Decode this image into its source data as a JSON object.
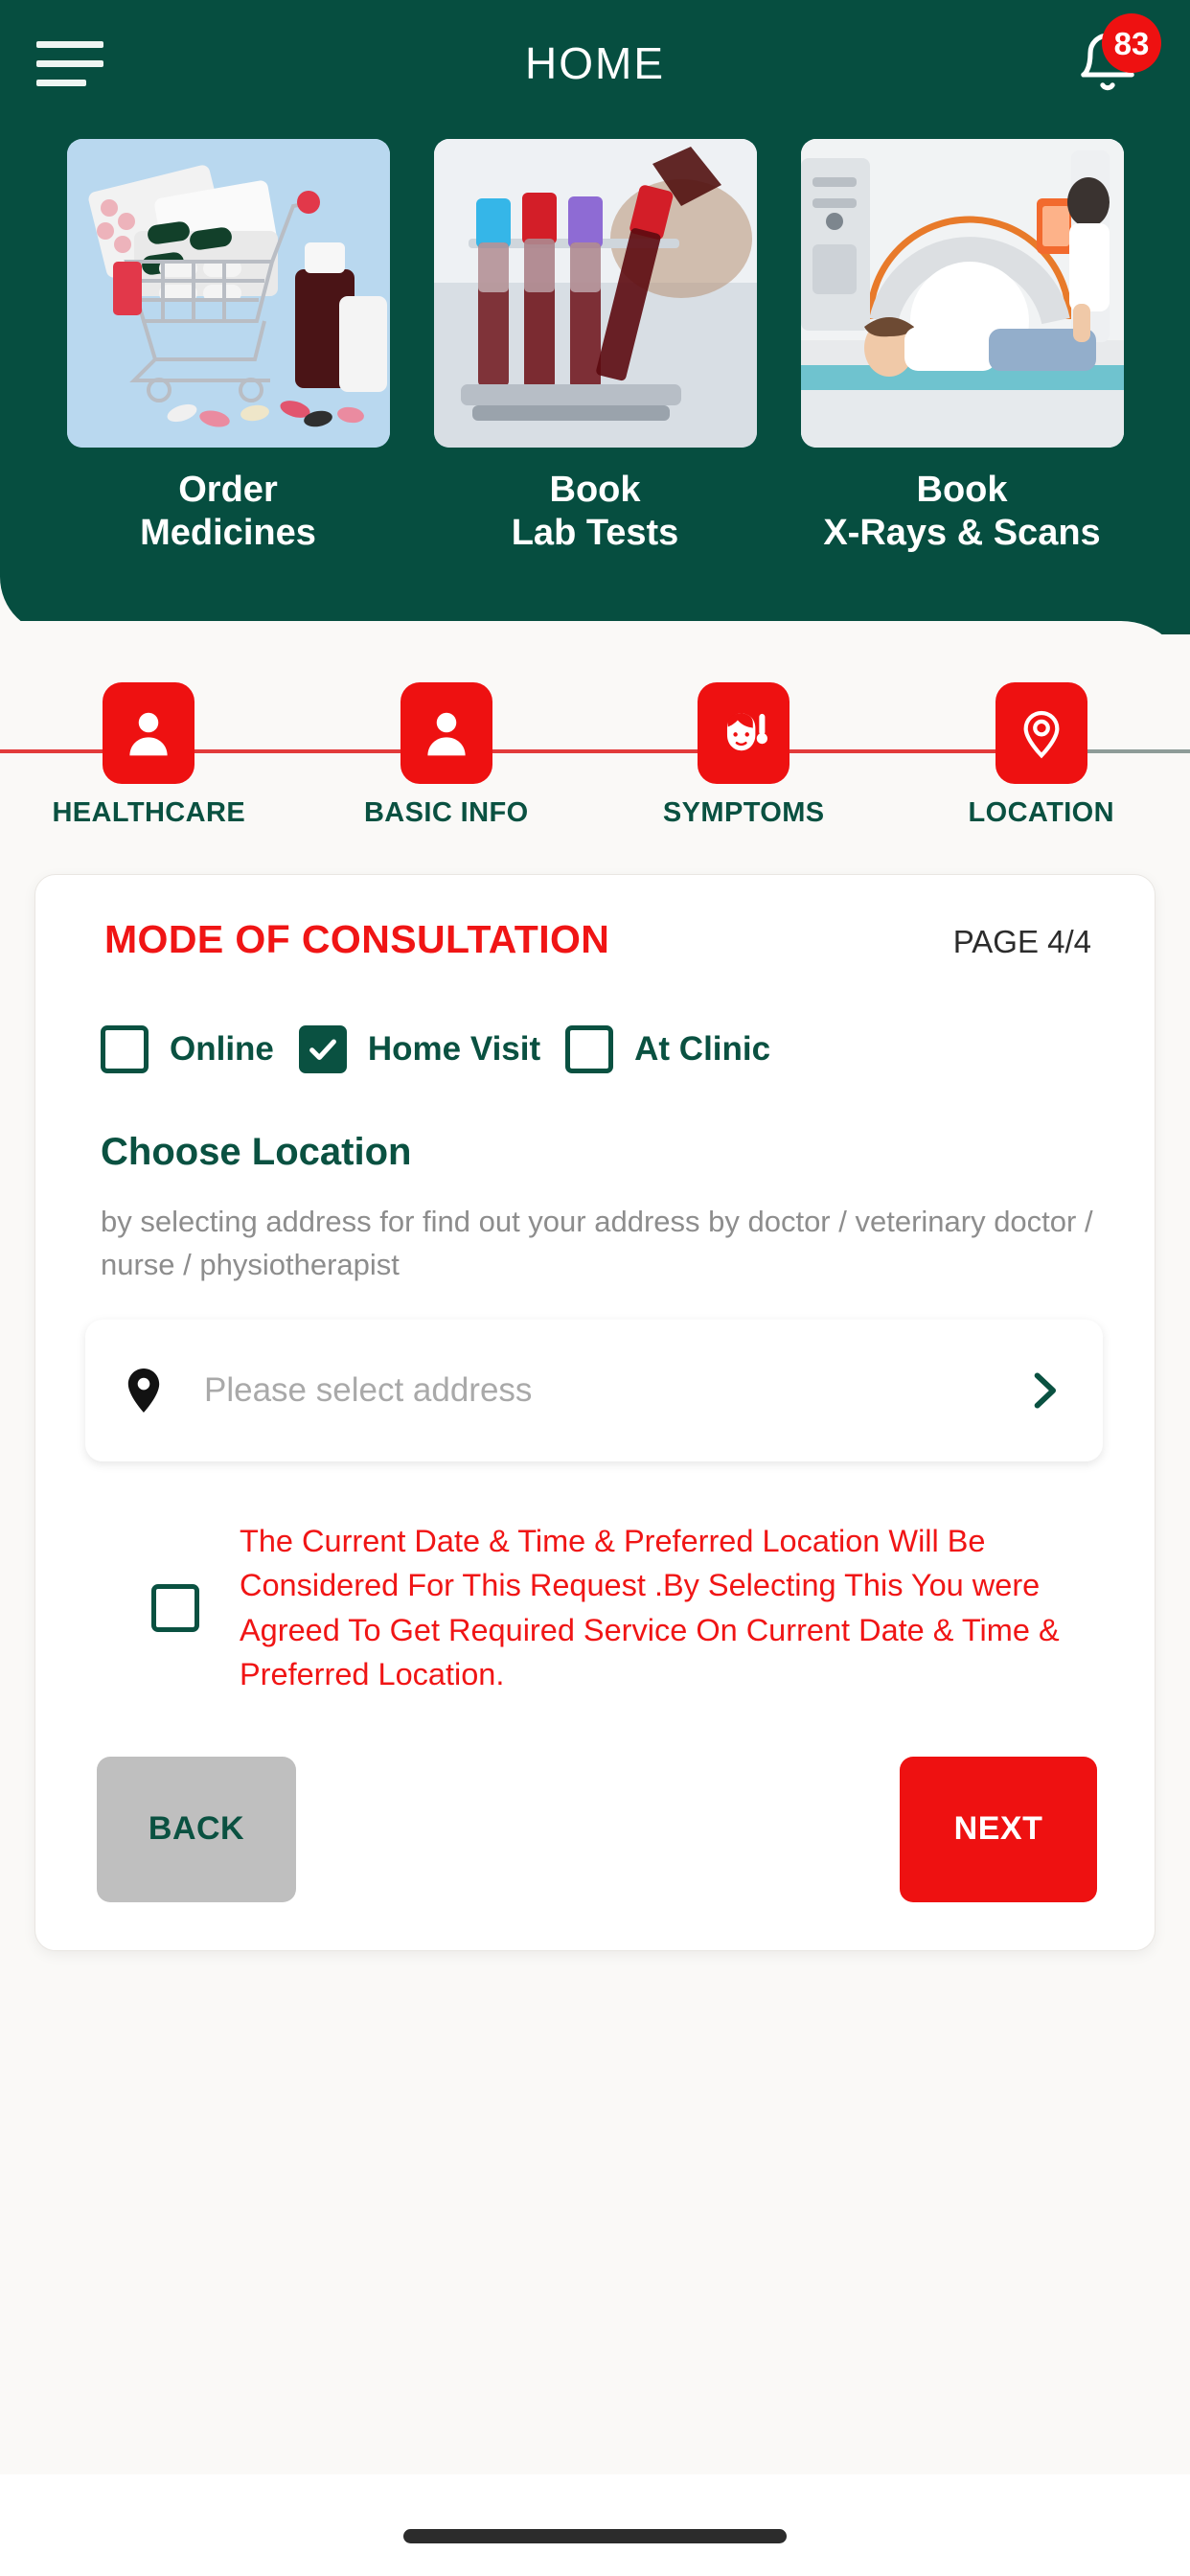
{
  "header": {
    "title": "HOME",
    "menu_icon": "hamburger-menu-icon",
    "notification_icon": "bell-icon",
    "notification_count": "83"
  },
  "services": [
    {
      "label": "Order\nMedicines",
      "image": "medicine-cart-photo"
    },
    {
      "label": "Book\nLab Tests",
      "image": "blood-test-tubes-photo"
    },
    {
      "label": "Book\nX-Rays & Scans",
      "image": "ct-scan-machine-photo"
    }
  ],
  "stepper": {
    "steps": [
      {
        "label": "HEALTHCARE",
        "icon": "person-icon"
      },
      {
        "label": "BASIC INFO",
        "icon": "person-icon"
      },
      {
        "label": "SYMPTOMS",
        "icon": "face-thermometer-icon"
      },
      {
        "label": "LOCATION",
        "icon": "location-pin-icon"
      }
    ],
    "active_index": 3
  },
  "form": {
    "title": "MODE OF CONSULTATION",
    "page_indicator": "PAGE 4/4",
    "modes": [
      {
        "label": "Online",
        "checked": false
      },
      {
        "label": "Home Visit",
        "checked": true
      },
      {
        "label": "At Clinic",
        "checked": false
      }
    ],
    "location": {
      "heading": "Choose Location",
      "subtitle": "by selecting address for find out your address by doctor / veterinary doctor / nurse / physiotherapist",
      "placeholder": "Please select address",
      "pin_icon": "map-pin-icon",
      "arrow_icon": "chevron-right-icon"
    },
    "disclaimer": {
      "text": "The Current Date & Time & Preferred Location Will Be Considered For This Request .By Selecting This You were Agreed To Get Required Service On Current Date & Time & Preferred Location.",
      "checked": false
    },
    "back_label": "BACK",
    "next_label": "NEXT"
  },
  "colors": {
    "brand_green": "#064e40",
    "accent_red": "#ee1111",
    "title_red": "#f01515",
    "label_green": "#0a5141",
    "muted_gray": "#8d8d8d",
    "back_gray": "#bfbfbf"
  }
}
